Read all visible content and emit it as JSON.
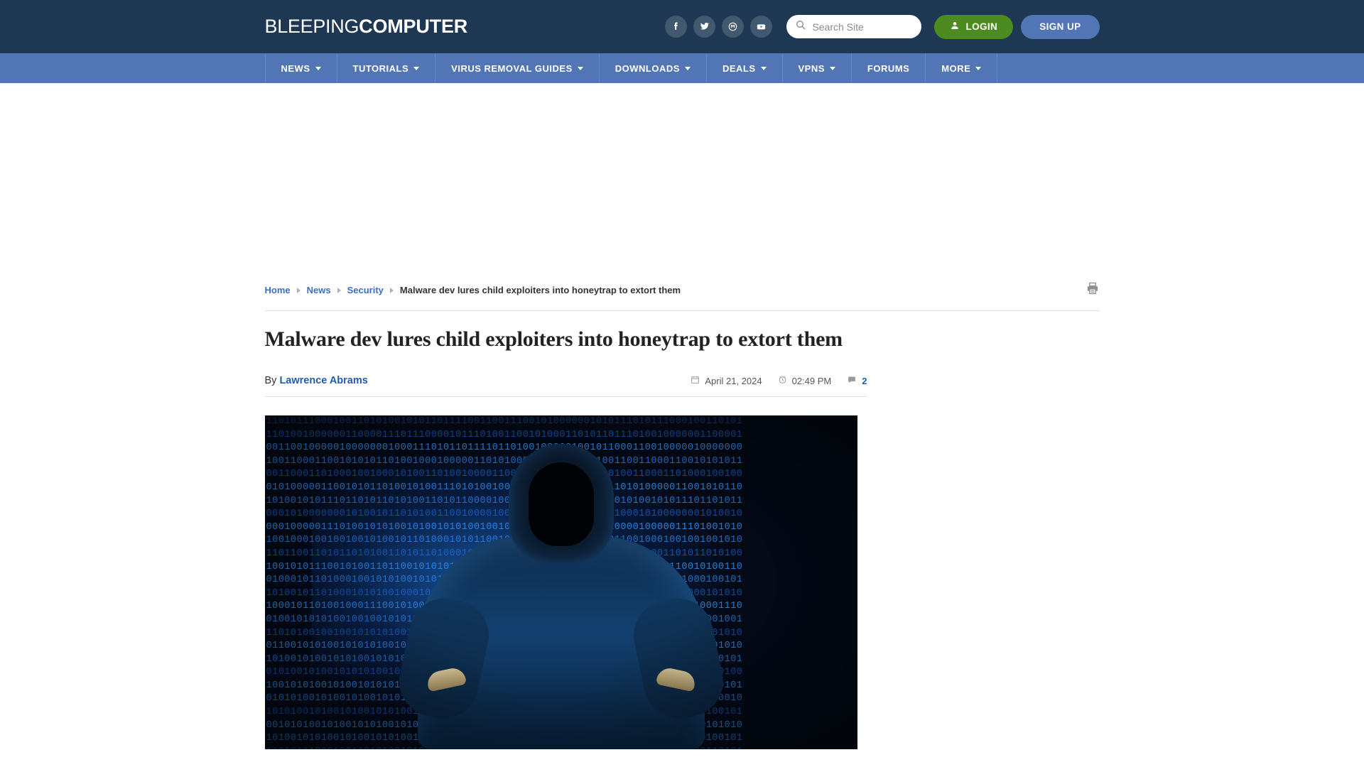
{
  "site": {
    "logo_light": "BLEEPING",
    "logo_bold": "COMPUTER"
  },
  "header": {
    "social": [
      {
        "name": "facebook-icon",
        "label": "Facebook"
      },
      {
        "name": "twitter-icon",
        "label": "Twitter"
      },
      {
        "name": "mastodon-icon",
        "label": "Mastodon"
      },
      {
        "name": "youtube-icon",
        "label": "YouTube"
      }
    ],
    "search": {
      "placeholder": "Search Site",
      "value": ""
    },
    "login_label": "LOGIN",
    "signup_label": "SIGN UP",
    "bg_color": "#1e3753"
  },
  "nav": {
    "bg_color": "#5175b5",
    "items": [
      {
        "label": "NEWS",
        "has_dropdown": true
      },
      {
        "label": "TUTORIALS",
        "has_dropdown": true
      },
      {
        "label": "VIRUS REMOVAL GUIDES",
        "has_dropdown": true
      },
      {
        "label": "DOWNLOADS",
        "has_dropdown": true
      },
      {
        "label": "DEALS",
        "has_dropdown": true
      },
      {
        "label": "VPNS",
        "has_dropdown": true
      },
      {
        "label": "FORUMS",
        "has_dropdown": false
      },
      {
        "label": "MORE",
        "has_dropdown": true
      }
    ]
  },
  "breadcrumb": {
    "items": [
      {
        "label": "Home",
        "link": true
      },
      {
        "label": "News",
        "link": true
      },
      {
        "label": "Security",
        "link": true
      },
      {
        "label": "Malware dev lures child exploiters into honeytrap to extort them",
        "link": false
      }
    ],
    "print_icon": "printer-icon"
  },
  "article": {
    "headline": "Malware dev lures child exploiters into honeytrap to extort them",
    "by_label": "By",
    "author": "Lawrence Abrams",
    "date": "April 21, 2024",
    "time": "02:49 PM",
    "comment_count": "2",
    "link_color": "#1f5cb0",
    "hero_alt": "Hooded figure in front of blue binary code background"
  },
  "hero_bits": [
    "1101011100010011010100101011011110011001110010100000010101",
    "1101001000000110000111011100001011101001100101000110101101",
    "0011001000001000000010001110101101111011010010000010010110",
    "1001100011001010101101001000100000110101000110010011011001",
    "0011000110100010010001010011010010000110001110101000011001",
    "0101000001100101011010010100111010100100001010000111001011",
    "1010010101110110101101010011010110000100100001000100110010",
    "0001010000000101001011010100110010000100110001011010010011",
    "0001000001110100101010010100101010010010100110100110010110",
    "1001000100100100101001011010001010110010101001110010001001",
    "1101100110101101010011010110100010010101010001011001010100",
    "1001010111001010011011001010101010010010100010100100110011",
    "0100010110100010010101001010110010101001010001101001010010",
    "1010010110100010101001000101101001010110010110100101001010",
    "1000101101001000111001010010101010010101001100101010010100",
    "0100101010100100100101010100101010010101010010010101010011",
    "1101010010010010101010010010101001010010101001010010100101",
    "0110010101001010101001010100101001010010101001010100101001",
    "1010010100101010010101001010010100101010010101001010010101",
    "0101001010010101010010100101001010100101001010100101001010",
    "1001010100101001010101001010010100101001010010101001010010",
    "0101010010100101001010101001010010101001010100101001010101",
    "1010100101001010010101001010010101001010100101001010010101",
    "0010101001010010101001010100101001010010101001010010101001",
    "1010010101001010010101001010010101001010010101001010100101"
  ]
}
